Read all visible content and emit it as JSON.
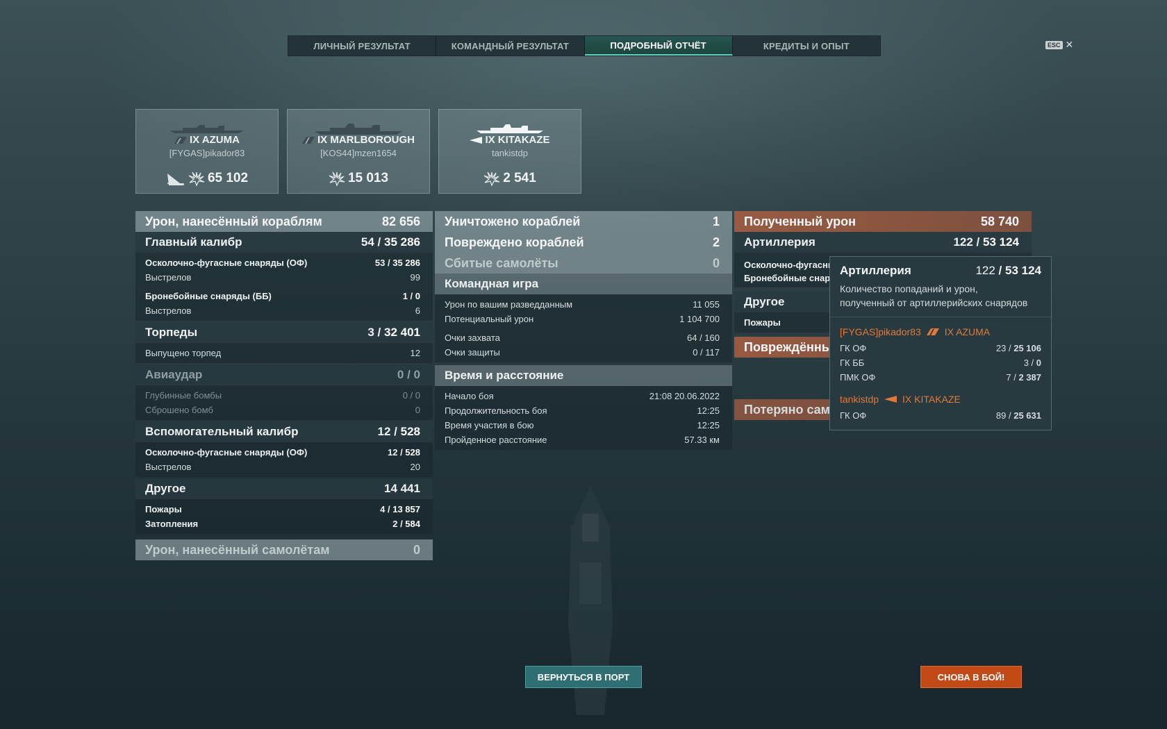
{
  "tabs": [
    "ЛИЧНЫЙ РЕЗУЛЬТАТ",
    "КОМАНДНЫЙ РЕЗУЛЬТАТ",
    "ПОДРОБНЫЙ ОТЧЁТ",
    "КРЕДИТЫ И ОПЫТ"
  ],
  "active_tab": "ПОДРОБНЫЙ ОТЧЁТ",
  "esc": {
    "key": "ESC",
    "close": "✕"
  },
  "ships": [
    {
      "name": "IX AZUMA",
      "player": "[FYGAS]pikador83",
      "damage": "65 102",
      "icon": "cruiser-icon",
      "extra_icon": "sunk-ship-icon"
    },
    {
      "name": "IX MARLBOROUGH",
      "player": "[KOS44]mzen1654",
      "damage": "15 013",
      "icon": "battleship-icon"
    },
    {
      "name": "IX KITAKAZE",
      "player": "tankistdp",
      "damage": "2 541",
      "icon": "destroyer-icon"
    }
  ],
  "left": {
    "header": {
      "label": "Урон, нанесённый кораблям",
      "value": "82 656"
    },
    "main_caliber": {
      "label": "Главный калибр",
      "hits": "54",
      "dmg": "35 286"
    },
    "he": {
      "label": "Осколочно-фугасные снаряды (ОФ)",
      "hits": "53",
      "dmg": "35 286"
    },
    "he_shots": {
      "label": "Выстрелов",
      "value": "99"
    },
    "ap": {
      "label": "Бронебойные снаряды (ББ)",
      "hits": "1",
      "dmg": "0"
    },
    "ap_shots": {
      "label": "Выстрелов",
      "value": "6"
    },
    "torpedoes": {
      "label": "Торпеды",
      "hits": "3",
      "dmg": "32 401"
    },
    "torp_launched": {
      "label": "Выпущено торпед",
      "value": "12"
    },
    "airstrike": {
      "label": "Авиаудар",
      "value": "0 / 0"
    },
    "depth": {
      "label": "Глубинные бомбы",
      "value": "0 / 0"
    },
    "dropped": {
      "label": "Сброшено бомб",
      "value": "0"
    },
    "secondary": {
      "label": "Вспомогательный калибр",
      "hits": "12",
      "dmg": "528"
    },
    "sec_he": {
      "label": "Осколочно-фугасные снаряды (ОФ)",
      "hits": "12",
      "dmg": "528"
    },
    "sec_shots": {
      "label": "Выстрелов",
      "value": "20"
    },
    "other": {
      "label": "Другое",
      "value": "14 441"
    },
    "fires": {
      "label": "Пожары",
      "hits": "4",
      "dmg": "13 857"
    },
    "floods": {
      "label": "Затопления",
      "hits": "2",
      "dmg": "584"
    },
    "planes_dmg": {
      "label": "Урон, нанесённый самолётам",
      "value": "0"
    }
  },
  "middle": {
    "destroyed": {
      "label": "Уничтожено кораблей",
      "value": "1"
    },
    "damaged": {
      "label": "Повреждено кораблей",
      "value": "2"
    },
    "planes": {
      "label": "Сбитые самолёты",
      "value": "0"
    },
    "team": {
      "label": "Командная игра"
    },
    "spotting": {
      "label": "Урон по вашим разведданным",
      "value": "11 055"
    },
    "potential": {
      "label": "Потенциальный урон",
      "value": "1 104 700"
    },
    "capture": {
      "label": "Очки захвата",
      "value": "64 / 160"
    },
    "defense": {
      "label": "Очки защиты",
      "value": "0 / 117"
    },
    "time": {
      "label": "Время и расстояние"
    },
    "start": {
      "label": "Начало боя",
      "value": "21:08  20.06.2022"
    },
    "duration": {
      "label": "Продолжительность боя",
      "value": "12:25"
    },
    "participation": {
      "label": "Время участия в бою",
      "value": "12:25"
    },
    "distance": {
      "label": "Пройденное расстояние",
      "value": "57.33 км"
    }
  },
  "right": {
    "received": {
      "label": "Полученный урон",
      "value": "58 740"
    },
    "artillery": {
      "label": "Артиллерия",
      "hits": "122",
      "dmg": "53 124"
    },
    "he_partial": "Осколочно-фугасные",
    "ap_partial": "Бронебойные снаряд",
    "other": "Другое",
    "fires": "Пожары",
    "damaged_partial": "Повреждённые",
    "lost_partial": "Потеряно само"
  },
  "tooltip": {
    "title": "Артиллерия",
    "hits": "122",
    "dmg": "53 124",
    "desc_line1": "Количество попаданий и урон,",
    "desc_line2": "полученный от артиллерийских снарядов",
    "players": [
      {
        "name": "[FYGAS]pikador83",
        "ship": "IX AZUMA",
        "icon": "cruiser-icon",
        "lines": [
          {
            "label": "ГК ОФ",
            "hits": "23",
            "dmg": "25 106"
          },
          {
            "label": "ГК ББ",
            "hits": "3",
            "dmg": "0"
          },
          {
            "label": "ПМК ОФ",
            "hits": "7",
            "dmg": "2 387"
          }
        ]
      },
      {
        "name": "tankistdp",
        "ship": "IX KITAKAZE",
        "icon": "destroyer-icon",
        "lines": [
          {
            "label": "ГК ОФ",
            "hits": "89",
            "dmg": "25 631"
          }
        ]
      }
    ]
  },
  "buttons": {
    "port": "ВЕРНУТЬСЯ В ПОРТ",
    "battle": "СНОВА В БОЙ!"
  },
  "colors": {
    "accent_teal": "#5fd3c0",
    "enemy_orange": "#e07a3a",
    "battle_button": "#c24a17"
  }
}
